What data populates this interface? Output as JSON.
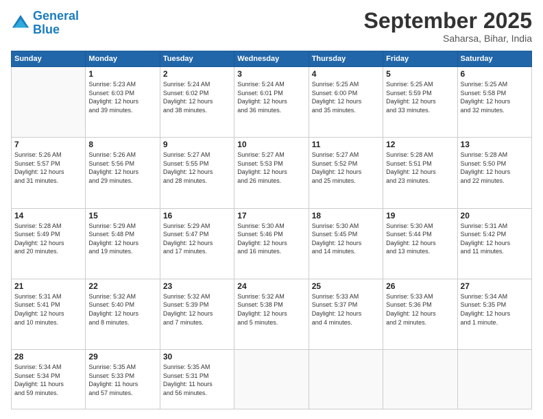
{
  "logo": {
    "line1": "General",
    "line2": "Blue"
  },
  "title": "September 2025",
  "location": "Saharsa, Bihar, India",
  "days_header": [
    "Sunday",
    "Monday",
    "Tuesday",
    "Wednesday",
    "Thursday",
    "Friday",
    "Saturday"
  ],
  "weeks": [
    [
      {
        "day": "",
        "info": ""
      },
      {
        "day": "1",
        "info": "Sunrise: 5:23 AM\nSunset: 6:03 PM\nDaylight: 12 hours\nand 39 minutes."
      },
      {
        "day": "2",
        "info": "Sunrise: 5:24 AM\nSunset: 6:02 PM\nDaylight: 12 hours\nand 38 minutes."
      },
      {
        "day": "3",
        "info": "Sunrise: 5:24 AM\nSunset: 6:01 PM\nDaylight: 12 hours\nand 36 minutes."
      },
      {
        "day": "4",
        "info": "Sunrise: 5:25 AM\nSunset: 6:00 PM\nDaylight: 12 hours\nand 35 minutes."
      },
      {
        "day": "5",
        "info": "Sunrise: 5:25 AM\nSunset: 5:59 PM\nDaylight: 12 hours\nand 33 minutes."
      },
      {
        "day": "6",
        "info": "Sunrise: 5:25 AM\nSunset: 5:58 PM\nDaylight: 12 hours\nand 32 minutes."
      }
    ],
    [
      {
        "day": "7",
        "info": "Sunrise: 5:26 AM\nSunset: 5:57 PM\nDaylight: 12 hours\nand 31 minutes."
      },
      {
        "day": "8",
        "info": "Sunrise: 5:26 AM\nSunset: 5:56 PM\nDaylight: 12 hours\nand 29 minutes."
      },
      {
        "day": "9",
        "info": "Sunrise: 5:27 AM\nSunset: 5:55 PM\nDaylight: 12 hours\nand 28 minutes."
      },
      {
        "day": "10",
        "info": "Sunrise: 5:27 AM\nSunset: 5:53 PM\nDaylight: 12 hours\nand 26 minutes."
      },
      {
        "day": "11",
        "info": "Sunrise: 5:27 AM\nSunset: 5:52 PM\nDaylight: 12 hours\nand 25 minutes."
      },
      {
        "day": "12",
        "info": "Sunrise: 5:28 AM\nSunset: 5:51 PM\nDaylight: 12 hours\nand 23 minutes."
      },
      {
        "day": "13",
        "info": "Sunrise: 5:28 AM\nSunset: 5:50 PM\nDaylight: 12 hours\nand 22 minutes."
      }
    ],
    [
      {
        "day": "14",
        "info": "Sunrise: 5:28 AM\nSunset: 5:49 PM\nDaylight: 12 hours\nand 20 minutes."
      },
      {
        "day": "15",
        "info": "Sunrise: 5:29 AM\nSunset: 5:48 PM\nDaylight: 12 hours\nand 19 minutes."
      },
      {
        "day": "16",
        "info": "Sunrise: 5:29 AM\nSunset: 5:47 PM\nDaylight: 12 hours\nand 17 minutes."
      },
      {
        "day": "17",
        "info": "Sunrise: 5:30 AM\nSunset: 5:46 PM\nDaylight: 12 hours\nand 16 minutes."
      },
      {
        "day": "18",
        "info": "Sunrise: 5:30 AM\nSunset: 5:45 PM\nDaylight: 12 hours\nand 14 minutes."
      },
      {
        "day": "19",
        "info": "Sunrise: 5:30 AM\nSunset: 5:44 PM\nDaylight: 12 hours\nand 13 minutes."
      },
      {
        "day": "20",
        "info": "Sunrise: 5:31 AM\nSunset: 5:42 PM\nDaylight: 12 hours\nand 11 minutes."
      }
    ],
    [
      {
        "day": "21",
        "info": "Sunrise: 5:31 AM\nSunset: 5:41 PM\nDaylight: 12 hours\nand 10 minutes."
      },
      {
        "day": "22",
        "info": "Sunrise: 5:32 AM\nSunset: 5:40 PM\nDaylight: 12 hours\nand 8 minutes."
      },
      {
        "day": "23",
        "info": "Sunrise: 5:32 AM\nSunset: 5:39 PM\nDaylight: 12 hours\nand 7 minutes."
      },
      {
        "day": "24",
        "info": "Sunrise: 5:32 AM\nSunset: 5:38 PM\nDaylight: 12 hours\nand 5 minutes."
      },
      {
        "day": "25",
        "info": "Sunrise: 5:33 AM\nSunset: 5:37 PM\nDaylight: 12 hours\nand 4 minutes."
      },
      {
        "day": "26",
        "info": "Sunrise: 5:33 AM\nSunset: 5:36 PM\nDaylight: 12 hours\nand 2 minutes."
      },
      {
        "day": "27",
        "info": "Sunrise: 5:34 AM\nSunset: 5:35 PM\nDaylight: 12 hours\nand 1 minute."
      }
    ],
    [
      {
        "day": "28",
        "info": "Sunrise: 5:34 AM\nSunset: 5:34 PM\nDaylight: 11 hours\nand 59 minutes."
      },
      {
        "day": "29",
        "info": "Sunrise: 5:35 AM\nSunset: 5:33 PM\nDaylight: 11 hours\nand 57 minutes."
      },
      {
        "day": "30",
        "info": "Sunrise: 5:35 AM\nSunset: 5:31 PM\nDaylight: 11 hours\nand 56 minutes."
      },
      {
        "day": "",
        "info": ""
      },
      {
        "day": "",
        "info": ""
      },
      {
        "day": "",
        "info": ""
      },
      {
        "day": "",
        "info": ""
      }
    ]
  ]
}
